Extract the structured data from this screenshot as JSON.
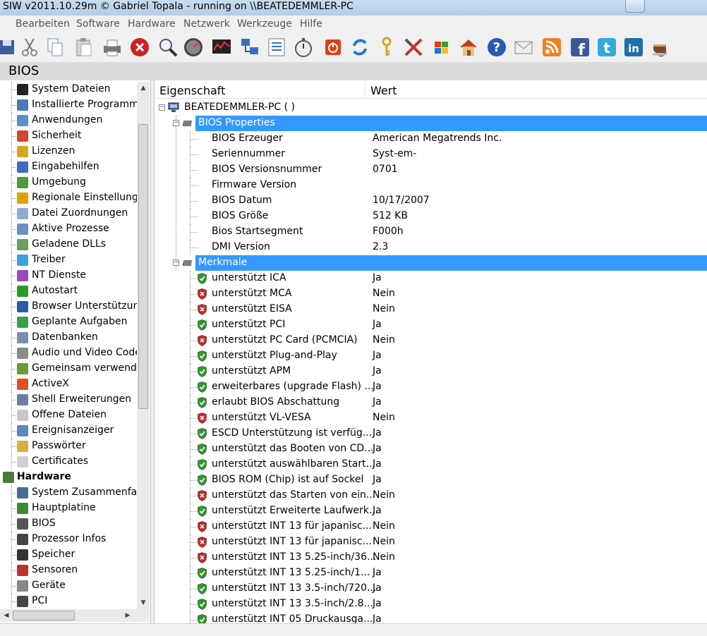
{
  "window": {
    "title": "SIW v2011.10.29m  © Gabriel Topala - running on \\\\BEATEDEMMLER-PC"
  },
  "menu": [
    "Bearbeiten",
    "Software",
    "Hardware",
    "Netzwerk",
    "Werkzeuge",
    "Hilfe"
  ],
  "toolbar_icons": [
    "save-icon",
    "cut-icon",
    "copy-icon",
    "paste-icon",
    "print-icon",
    "stop-icon",
    "search-icon",
    "speedometer-icon",
    "monitor-icon",
    "network-icon",
    "list-icon",
    "stopwatch-icon",
    "shutdown-icon",
    "refresh-icon",
    "key-icon",
    "tools-icon",
    "windows-icon",
    "home-icon",
    "help-icon",
    "mail-icon",
    "rss-icon",
    "facebook-icon",
    "twitter-icon",
    "linkedin-icon",
    "coffee-icon"
  ],
  "section_title": "BIOS",
  "sidebar": {
    "items": [
      {
        "label": "System Dateien",
        "icon": "console-icon",
        "color": "#222222"
      },
      {
        "label": "Installierte Programme",
        "icon": "programs-icon",
        "color": "#4a7ab5"
      },
      {
        "label": "Anwendungen",
        "icon": "applications-icon",
        "color": "#5a8fd0"
      },
      {
        "label": "Sicherheit",
        "icon": "shield-icon",
        "color": "#d04a2a"
      },
      {
        "label": "Lizenzen",
        "icon": "lock-icon",
        "color": "#d8a520"
      },
      {
        "label": "Eingabehilfen",
        "icon": "accessibility-icon",
        "color": "#3a6fc0"
      },
      {
        "label": "Umgebung",
        "icon": "environment-icon",
        "color": "#4c9a3a"
      },
      {
        "label": "Regionale Einstellungen",
        "icon": "regional-icon",
        "color": "#e0a000"
      },
      {
        "label": "Datei Zuordnungen",
        "icon": "file-assoc-icon",
        "color": "#8fa9cf"
      },
      {
        "label": "Aktive Prozesse",
        "icon": "process-icon",
        "color": "#6a8fc8"
      },
      {
        "label": "Geladene DLLs",
        "icon": "dll-icon",
        "color": "#6a9f5a"
      },
      {
        "label": "Treiber",
        "icon": "driver-icon",
        "color": "#3aa0e0"
      },
      {
        "label": "NT Dienste",
        "icon": "services-icon",
        "color": "#9a4ac0"
      },
      {
        "label": "Autostart",
        "icon": "autostart-icon",
        "color": "#2a9a2a"
      },
      {
        "label": "Browser Unterstützung",
        "icon": "browser-icon",
        "color": "#2a5ab0"
      },
      {
        "label": "Geplante Aufgaben",
        "icon": "tasks-icon",
        "color": "#3aa04a"
      },
      {
        "label": "Datenbanken",
        "icon": "database-icon",
        "color": "#7a8fb0"
      },
      {
        "label": "Audio und Video Codecs",
        "icon": "codecs-icon",
        "color": "#8a8a8a"
      },
      {
        "label": "Gemeinsam verwendete",
        "icon": "shared-icon",
        "color": "#6a9a3a"
      },
      {
        "label": "ActiveX",
        "icon": "activex-icon",
        "color": "#e05020"
      },
      {
        "label": "Shell Erweiterungen",
        "icon": "shell-icon",
        "color": "#6a7fa0"
      },
      {
        "label": "Offene Dateien",
        "icon": "open-files-icon",
        "color": "#c8c8c8"
      },
      {
        "label": "Ereignisanzeiger",
        "icon": "event-viewer-icon",
        "color": "#5a8ac0"
      },
      {
        "label": "Passwörter",
        "icon": "key-icon",
        "color": "#d8b040"
      },
      {
        "label": "Certificates",
        "icon": "certificate-icon",
        "color": "#d0d0d0"
      }
    ],
    "group": {
      "label": "Hardware",
      "icon": "hardware-icon"
    },
    "hw_items": [
      {
        "label": "System Zusammenfassung",
        "icon": "summary-icon",
        "color": "#4a6a9a"
      },
      {
        "label": "Hauptplatine",
        "icon": "motherboard-icon",
        "color": "#3a8a3a"
      },
      {
        "label": "BIOS",
        "icon": "bios-chip-icon",
        "color": "#555555"
      },
      {
        "label": "Prozessor Infos",
        "icon": "cpu-icon",
        "color": "#444444"
      },
      {
        "label": "Speicher",
        "icon": "memory-icon",
        "color": "#333333"
      },
      {
        "label": "Sensoren",
        "icon": "sensor-icon",
        "color": "#c03030"
      },
      {
        "label": "Geräte",
        "icon": "devices-icon",
        "color": "#888888"
      },
      {
        "label": "PCI",
        "icon": "pci-icon",
        "color": "#444444"
      }
    ]
  },
  "main": {
    "col_property": "Eigenschaft",
    "col_value": "Wert",
    "root": "BEATEDEMMLER-PC ( )",
    "bios_group": "BIOS Properties",
    "bios_props": [
      {
        "k": "BIOS Erzeuger",
        "v": "American Megatrends Inc."
      },
      {
        "k": "Seriennummer",
        "v": "Syst-em-"
      },
      {
        "k": "BIOS Versionsnummer",
        "v": "0701"
      },
      {
        "k": "Firmware Version",
        "v": ""
      },
      {
        "k": "BIOS Datum",
        "v": "10/17/2007"
      },
      {
        "k": "BIOS Größe",
        "v": "512 KB"
      },
      {
        "k": "Bios Startsegment",
        "v": "F000h"
      },
      {
        "k": "DMI Version",
        "v": "2.3"
      }
    ],
    "features_group": "Merkmale",
    "features": [
      {
        "k": "unterstützt ICA",
        "v": "Ja"
      },
      {
        "k": "unterstützt MCA",
        "v": "Nein"
      },
      {
        "k": "unterstützt EISA",
        "v": "Nein"
      },
      {
        "k": "unterstützt PCI",
        "v": "Ja"
      },
      {
        "k": "unterstützt PC Card (PCMCIA)",
        "v": "Nein"
      },
      {
        "k": "unterstützt Plug-and-Play",
        "v": "Ja"
      },
      {
        "k": "unterstützt APM",
        "v": "Ja"
      },
      {
        "k": "erweiterbares (upgrade Flash) ...",
        "v": "Ja"
      },
      {
        "k": "erlaubt BIOS Abschattung",
        "v": "Ja"
      },
      {
        "k": "unterstützt VL-VESA",
        "v": "Nein"
      },
      {
        "k": "ESCD Unterstützung ist verfüg...",
        "v": "Ja"
      },
      {
        "k": "unterstützt das Booten von CD...",
        "v": "Ja"
      },
      {
        "k": "unterstützt auswählbaren Start...",
        "v": "Ja"
      },
      {
        "k": "BIOS ROM (Chip) ist auf Sockel",
        "v": "Ja"
      },
      {
        "k": "unterstützt das Starten von ein...",
        "v": "Nein"
      },
      {
        "k": "unterstützt Erweiterte Laufwerk...",
        "v": "Ja"
      },
      {
        "k": "unterstützt INT 13 für japanisc...",
        "v": "Nein"
      },
      {
        "k": "unterstützt INT 13 für japanisc...",
        "v": "Nein"
      },
      {
        "k": "unterstützt INT 13 5.25-inch/36...",
        "v": "Nein"
      },
      {
        "k": "unterstützt INT 13 5.25-inch/1...",
        "v": "Ja"
      },
      {
        "k": "unterstützt INT 13 3.5-inch/720...",
        "v": "Ja"
      },
      {
        "k": "unterstützt INT 13 3.5-inch/2.8...",
        "v": "Ja"
      },
      {
        "k": "unterstützt INT 05 Druckausga...",
        "v": "Ja"
      }
    ]
  },
  "colors": {
    "selection": "#3399ff",
    "shield_yes": "#2e9a2e",
    "shield_no": "#c82828"
  }
}
